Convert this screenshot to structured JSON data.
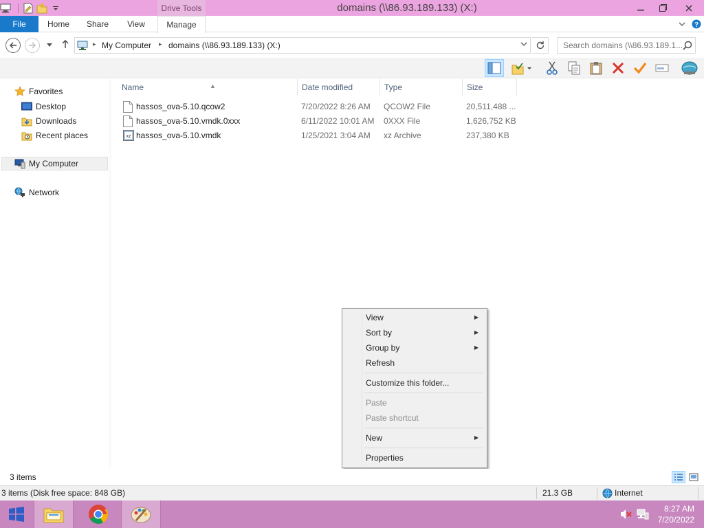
{
  "window": {
    "title": "domains (\\\\86.93.189.133) (X:)",
    "contextual_tab_group": "Drive Tools"
  },
  "ribbon": {
    "tabs": [
      "File",
      "Home",
      "Share",
      "View",
      "Manage"
    ]
  },
  "address": {
    "crumbs": [
      "My Computer",
      "domains (\\\\86.93.189.133) (X:)"
    ]
  },
  "search": {
    "placeholder": "Search domains (\\\\86.93.189.1..."
  },
  "nav": {
    "favorites": "Favorites",
    "favorite_items": [
      "Desktop",
      "Downloads",
      "Recent places"
    ],
    "computer": "My Computer",
    "network": "Network"
  },
  "columns": {
    "name": "Name",
    "date": "Date modified",
    "type": "Type",
    "size": "Size"
  },
  "files": [
    {
      "name": "hassos_ova-5.10.qcow2",
      "date": "7/20/2022 8:26 AM",
      "type": "QCOW2 File",
      "size": "20,511,488 ..."
    },
    {
      "name": "hassos_ova-5.10.vmdk.0xxx",
      "date": "6/11/2022 10:01 AM",
      "type": "0XXX File",
      "size": "1,626,752 KB"
    },
    {
      "name": "hassos_ova-5.10.vmdk",
      "date": "1/25/2021 3:04 AM",
      "type": "xz Archive",
      "size": "237,380 KB"
    }
  ],
  "context_menu": {
    "view": "View",
    "sort_by": "Sort by",
    "group_by": "Group by",
    "refresh": "Refresh",
    "customize": "Customize this folder...",
    "paste": "Paste",
    "paste_shortcut": "Paste shortcut",
    "new": "New",
    "properties": "Properties"
  },
  "status": {
    "item_count": "3 items",
    "details": "3 items (Disk free space: 848 GB)",
    "size": "21.3 GB",
    "zone": "Internet"
  },
  "taskbar": {
    "time": "8:27 AM",
    "date": "7/20/2022"
  },
  "colors": {
    "titlebar": "#eca4e0",
    "file_tab": "#1979ca",
    "taskbar": "#c888bf"
  }
}
